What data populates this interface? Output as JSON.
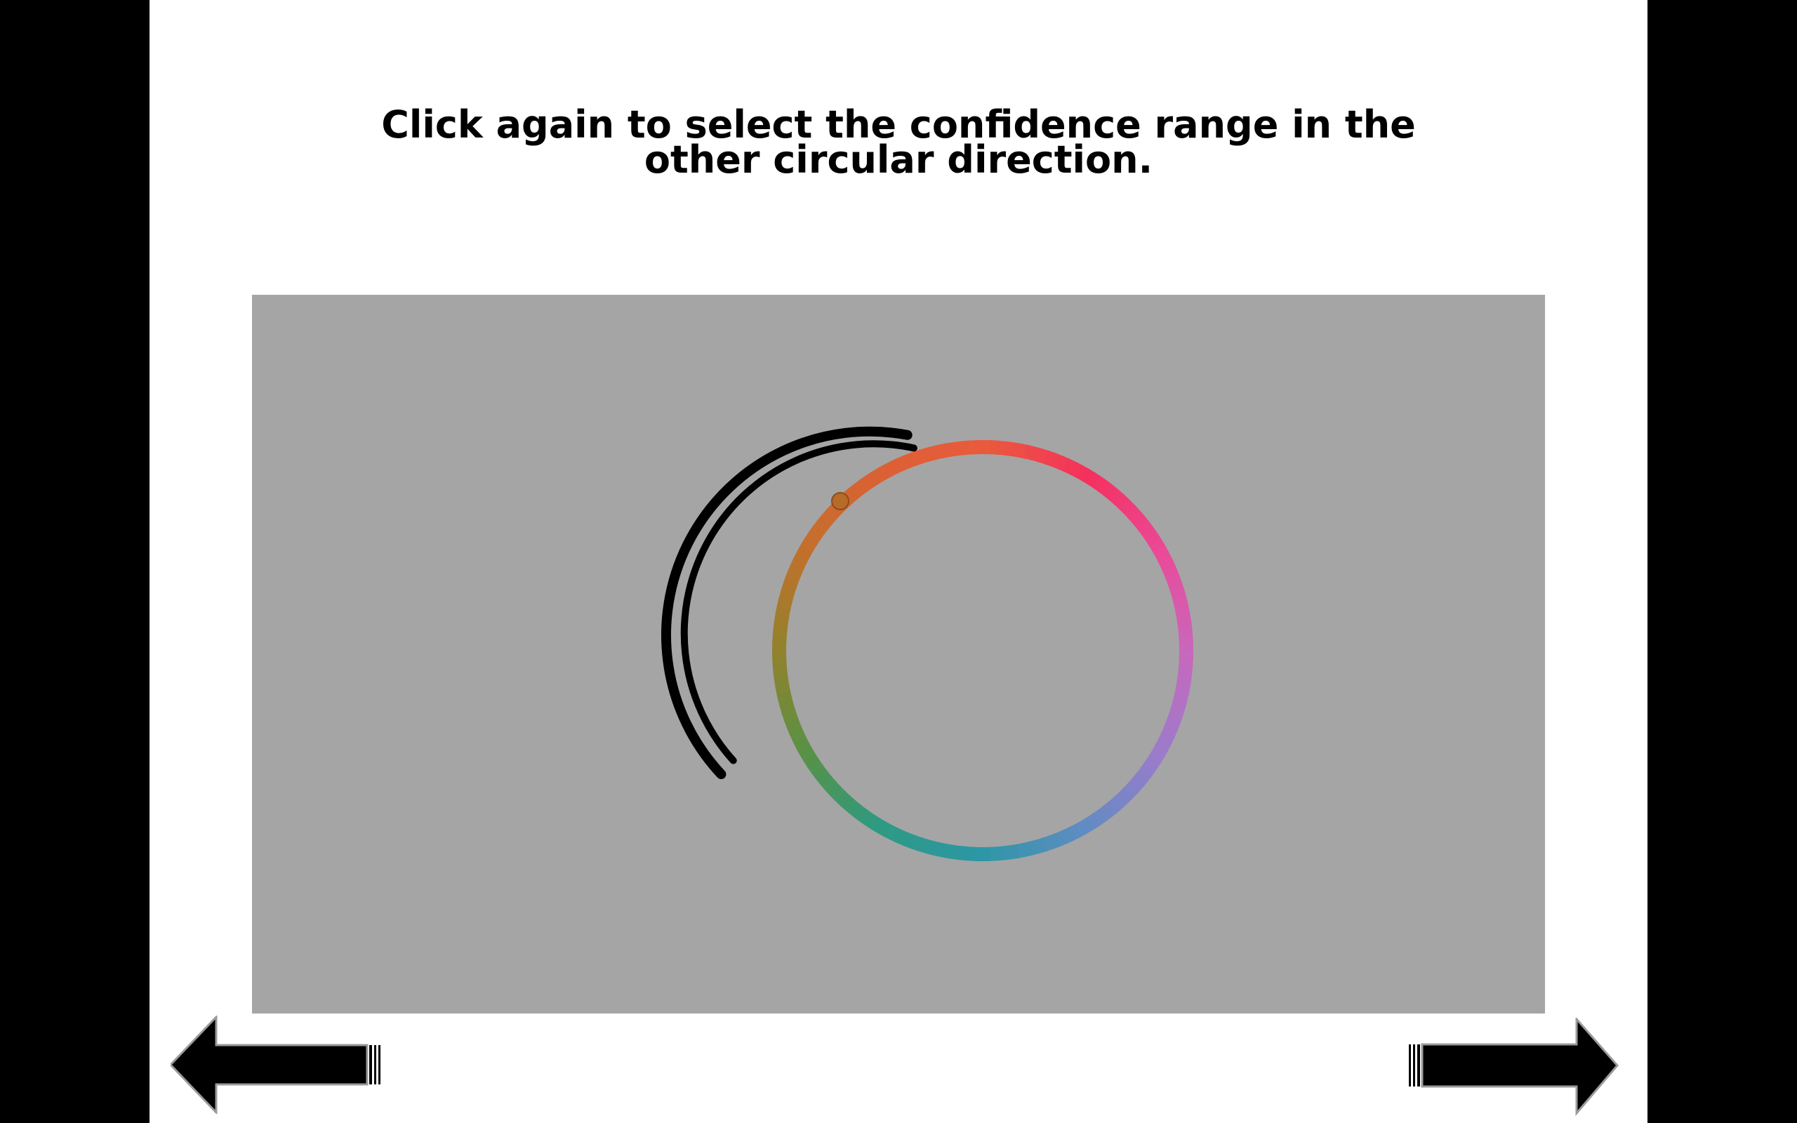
{
  "instruction": {
    "line1": "Click again to select the confidence range in the",
    "line2": "other circular direction."
  },
  "color_wheel": {
    "colors": {
      "background_panel": "#a5a5a5",
      "selection_outline": "#000000"
    },
    "gradient_stops_clockwise_from_top": [
      "#ea5a3c",
      "#f5305e",
      "#ea4a98",
      "#c768bd",
      "#9a7ccb",
      "#5f8cc2",
      "#2c97a5",
      "#2e9a82",
      "#5a9144",
      "#94812c",
      "#c46f2c",
      "#dc6035"
    ]
  },
  "navigation": {
    "back_icon": "left-arrow-icon",
    "next_icon": "right-arrow-icon"
  }
}
